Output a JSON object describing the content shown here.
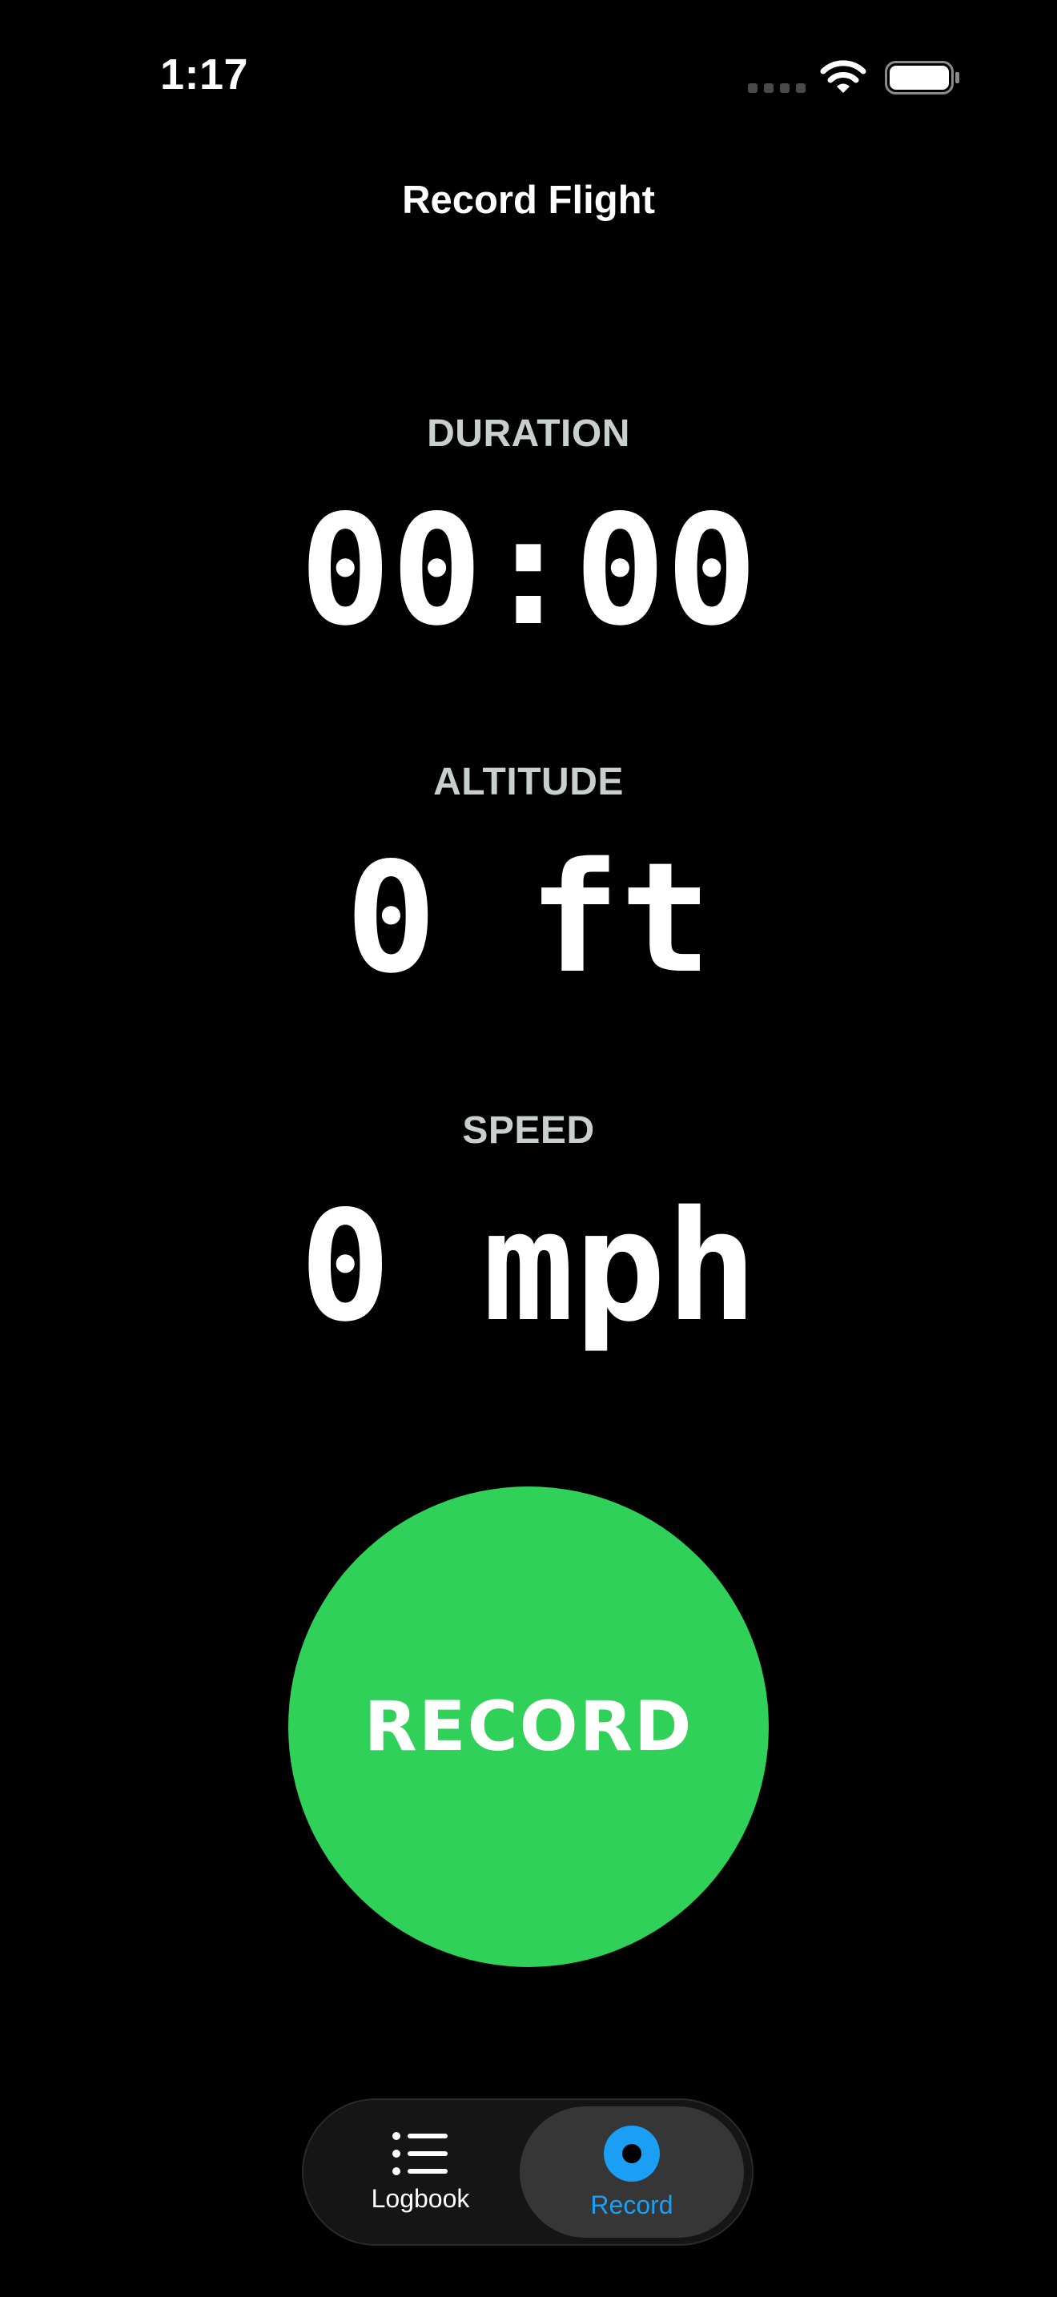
{
  "status_bar": {
    "time": "1:17"
  },
  "header": {
    "title": "Record Flight"
  },
  "metrics": {
    "duration": {
      "label": "DURATION",
      "value": "00:00"
    },
    "altitude": {
      "label": "ALTITUDE",
      "value": "0 ft"
    },
    "speed": {
      "label": "SPEED",
      "value": "0 mph"
    }
  },
  "record_button": {
    "label": "RECORD",
    "color": "#30d158"
  },
  "tab_bar": {
    "tabs": [
      {
        "label": "Logbook",
        "icon": "list-icon",
        "selected": false
      },
      {
        "label": "Record",
        "icon": "record-icon",
        "selected": true
      }
    ],
    "accent_color": "#1a9ff5"
  }
}
